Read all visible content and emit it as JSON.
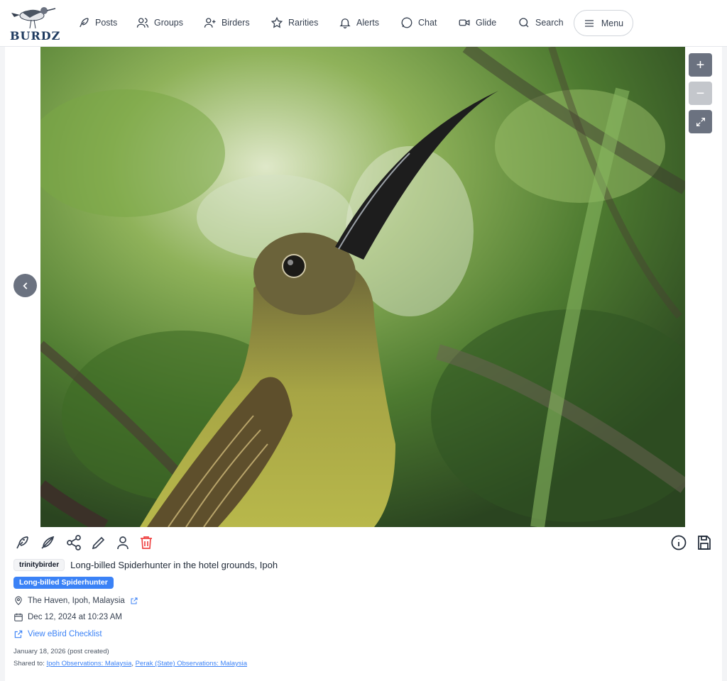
{
  "brand": {
    "name": "BURDZ"
  },
  "nav": {
    "items": [
      {
        "label": "Posts",
        "icon": "feather-icon"
      },
      {
        "label": "Groups",
        "icon": "users-icon"
      },
      {
        "label": "Birders",
        "icon": "user-plus-icon"
      },
      {
        "label": "Rarities",
        "icon": "star-icon"
      },
      {
        "label": "Alerts",
        "icon": "bell-icon"
      },
      {
        "label": "Chat",
        "icon": "chat-bubble-icon"
      },
      {
        "label": "Glide",
        "icon": "video-icon"
      },
      {
        "label": "Search",
        "icon": "search-icon"
      }
    ],
    "menu_label": "Menu"
  },
  "viewer": {
    "zoom_in_symbol": "+",
    "zoom_out_symbol": "−",
    "icons": [
      "plus-icon",
      "minus-icon",
      "expand-icon",
      "chevron-left-icon"
    ]
  },
  "post": {
    "username": "trinitybirder",
    "caption": "Long-billed Spiderhunter in the hotel grounds, Ipoh",
    "species_tag": "Long-billed Spiderhunter",
    "location": "The Haven, Ipoh, Malaysia",
    "observed_at": "Dec 12, 2024 at 10:23 AM",
    "ebird_link_label": "View eBird Checklist",
    "created_note": "January 18, 2026 (post created)",
    "shared_to_label": "Shared to:",
    "shared_groups": [
      "Ipoh Observations: Malaysia",
      "Perak (State) Observations: Malaysia"
    ],
    "shared_separator": ","
  },
  "actions": {
    "icons": [
      "bird-icon",
      "feather-icon",
      "share-icon",
      "edit-icon",
      "user-icon",
      "trash-icon",
      "info-icon",
      "save-icon"
    ]
  },
  "colors": {
    "accent": "#3b82f6",
    "danger": "#ef4444",
    "nav_text": "#374151",
    "brand": "#1e3a5f"
  }
}
